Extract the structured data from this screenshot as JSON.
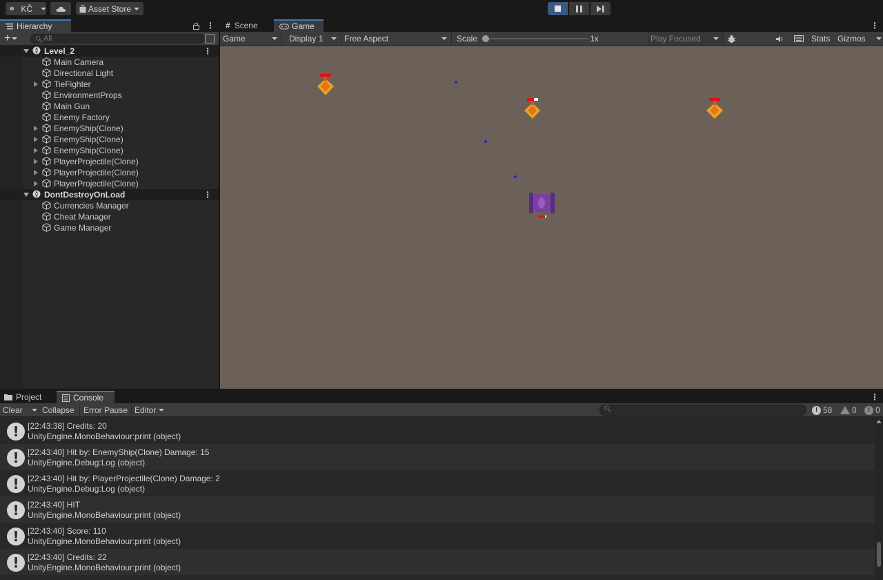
{
  "toolbar": {
    "account_label": "KČ",
    "asset_store_label": "Asset Store"
  },
  "hierarchy": {
    "tab_label": "Hierarchy",
    "search_placeholder": "All",
    "scenes": [
      {
        "name": "Level_2",
        "children": [
          {
            "label": "Main Camera",
            "expandable": false
          },
          {
            "label": "Directional Light",
            "expandable": false
          },
          {
            "label": "TieFighter",
            "expandable": true
          },
          {
            "label": "EnvironmentProps",
            "expandable": false
          },
          {
            "label": "Main Gun",
            "expandable": false
          },
          {
            "label": "Enemy Factory",
            "expandable": false
          },
          {
            "label": "EnemyShip(Clone)",
            "expandable": true
          },
          {
            "label": "EnemyShip(Clone)",
            "expandable": true
          },
          {
            "label": "EnemyShip(Clone)",
            "expandable": true
          },
          {
            "label": "PlayerProjectile(Clone)",
            "expandable": true
          },
          {
            "label": "PlayerProjectile(Clone)",
            "expandable": true
          },
          {
            "label": "PlayerProjectile(Clone)",
            "expandable": true
          }
        ]
      },
      {
        "name": "DontDestroyOnLoad",
        "children": [
          {
            "label": "Currencies Manager",
            "expandable": false
          },
          {
            "label": "Cheat Manager",
            "expandable": false
          },
          {
            "label": "Game Manager",
            "expandable": false
          }
        ]
      }
    ]
  },
  "game_view": {
    "tabs": [
      {
        "label": "Scene",
        "icon": "grid-icon"
      },
      {
        "label": "Game",
        "icon": "gamepad-icon"
      }
    ],
    "view_mode": "Game",
    "display": "Display 1",
    "aspect": "Free Aspect",
    "scale_label": "Scale",
    "scale_value": "1x",
    "play_mode": "Play Focused",
    "stats_label": "Stats",
    "gizmos_label": "Gizmos",
    "background_color": "#6b6158"
  },
  "console": {
    "tabs": [
      {
        "label": "Project",
        "icon": "folder-icon"
      },
      {
        "label": "Console",
        "icon": "console-icon"
      }
    ],
    "clear_label": "Clear",
    "collapse_label": "Collapse",
    "error_pause_label": "Error Pause",
    "editor_label": "Editor",
    "log_count": "58",
    "warning_count": "0",
    "error_count": "0",
    "entries": [
      {
        "message": "[22:43:38] Credits: 20",
        "source": "UnityEngine.MonoBehaviour:print (object)"
      },
      {
        "message": "[22:43:40] Hit by: EnemyShip(Clone) Damage: 15",
        "source": "UnityEngine.Debug:Log (object)"
      },
      {
        "message": "[22:43:40] Hit by: PlayerProjectile(Clone) Damage: 2",
        "source": "UnityEngine.Debug:Log (object)"
      },
      {
        "message": "[22:43:40] HIT",
        "source": "UnityEngine.MonoBehaviour:print (object)"
      },
      {
        "message": "[22:43:40] Score: 110",
        "source": "UnityEngine.MonoBehaviour:print (object)"
      },
      {
        "message": "[22:43:40] Credits: 22",
        "source": "UnityEngine.MonoBehaviour:print (object)"
      }
    ]
  },
  "colors": {
    "accent": "#3a79bb",
    "play_active": "#3b5a84",
    "enemy_ship": "#f0a020",
    "player_ship": "#7a3fa0",
    "health_bar": "#e01010",
    "projectile": "#1a2cd8"
  }
}
